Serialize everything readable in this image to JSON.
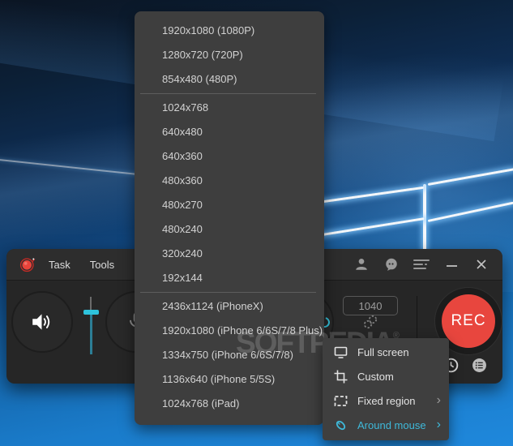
{
  "window": {
    "menus": [
      "Task",
      "Tools"
    ],
    "titlebar_icons": [
      "user-icon",
      "feedback-icon",
      "menu-icon",
      "minimize-button",
      "close-button"
    ]
  },
  "controls": {
    "size_value": "1040",
    "rec_label": "REC"
  },
  "resolution_menu": {
    "groups": [
      {
        "items": [
          "1920x1080 (1080P)",
          "1280x720 (720P)",
          "854x480 (480P)"
        ]
      },
      {
        "items": [
          "1024x768",
          "640x480",
          "640x360",
          "480x360",
          "480x270",
          "480x240",
          "320x240",
          "192x144"
        ]
      },
      {
        "items": [
          "2436x1124 (iPhoneX)",
          "1920x1080 (iPhone 6/6S/7/8 Plus)",
          "1334x750 (iPhone 6/6S/7/8)",
          "1136x640 (iPhone 5/5S)",
          "1024x768 (iPad)"
        ]
      }
    ]
  },
  "region_menu": {
    "items": [
      {
        "label": "Full screen",
        "icon": "monitor-icon",
        "has_submenu": false,
        "active": false
      },
      {
        "label": "Custom",
        "icon": "crop-icon",
        "has_submenu": false,
        "active": false
      },
      {
        "label": "Fixed region",
        "icon": "region-icon",
        "has_submenu": true,
        "active": false
      },
      {
        "label": "Around mouse",
        "icon": "mouse-icon",
        "has_submenu": true,
        "active": true
      }
    ],
    "chevron": "›"
  },
  "watermark": {
    "text": "SOFTPEDIA",
    "reg_mark": "®"
  },
  "colors": {
    "accent_cyan": "#3fb9da",
    "rec_red": "#e8463e",
    "logo_red": "#e23b33",
    "menu_bg": "#3e3e3e",
    "window_bg": "#262626"
  }
}
